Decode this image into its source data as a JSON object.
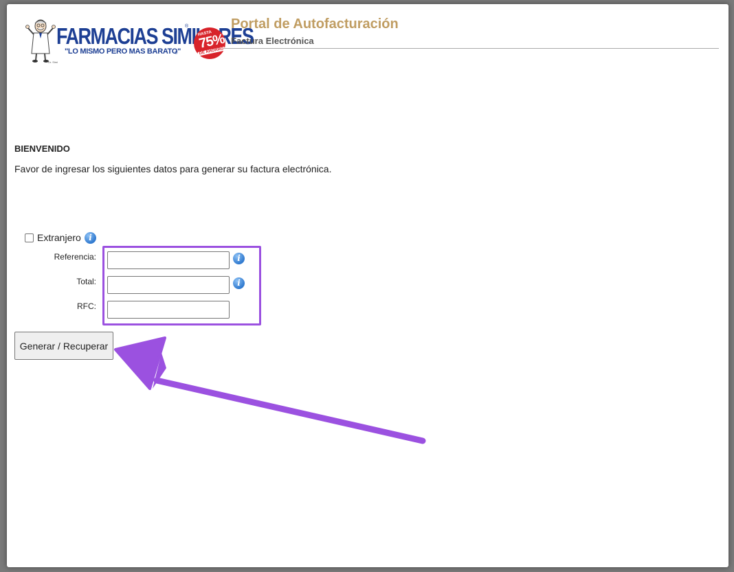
{
  "header": {
    "brand_name": "FARMACIAS SIMILARES",
    "brand_reg": "®",
    "slogan": "\"LO MISMO PERO MAS BARATO\"",
    "slogan_mark": "®",
    "badge_top": "HASTA",
    "badge_pct": "75%",
    "badge_bottom": "DE AHORRO",
    "doctor_sig": "Dr. Simi",
    "portal_title": "Portal de Autofacturación",
    "portal_subtitle": "Factura Electrónica"
  },
  "welcome": {
    "title": "BIENVENIDO",
    "text": "Favor de ingresar los siguientes datos para generar su factura electrónica."
  },
  "form": {
    "extranjero_label": "Extranjero",
    "extranjero_checked": false,
    "fields": [
      {
        "label": "Referencia:",
        "value": "",
        "has_info": true
      },
      {
        "label": "Total:",
        "value": "",
        "has_info": true
      },
      {
        "label": "RFC:",
        "value": "",
        "has_info": false
      }
    ],
    "submit_label": "Generar / Recuperar"
  },
  "icons": {
    "info": "info-icon",
    "logo": "farmacias-similares-logo"
  },
  "colors": {
    "brand_blue": "#1d3f94",
    "title_gold": "#c09d62",
    "badge_red": "#d8232a",
    "annotation_purple": "#9b51e0"
  }
}
